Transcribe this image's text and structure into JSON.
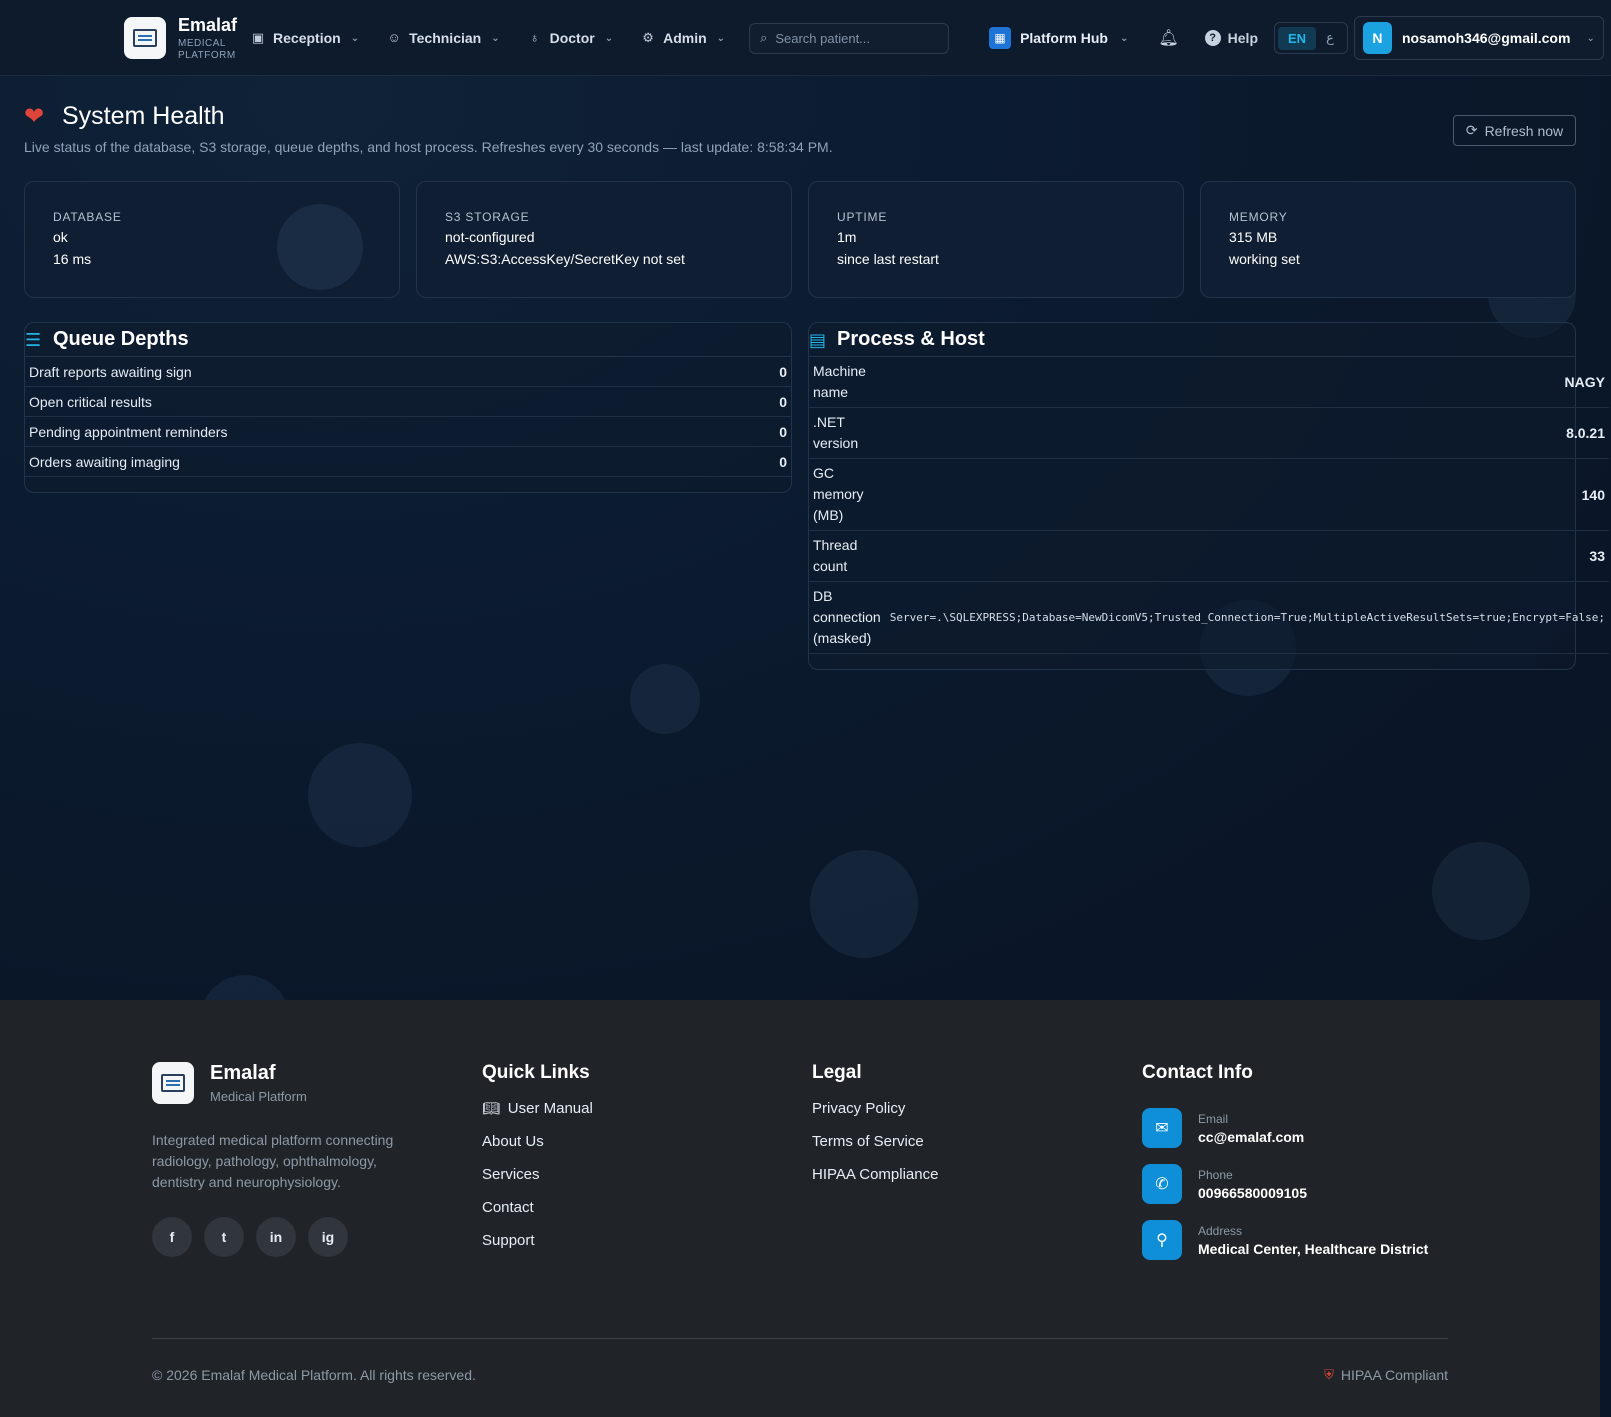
{
  "navbar": {
    "brand_name": "Emalaf",
    "brand_sub_1": "MEDICAL",
    "brand_sub_2": "PLATFORM",
    "menu": [
      {
        "label": "Reception",
        "icon": "clipboard-icon"
      },
      {
        "label": "Technician",
        "icon": "user-icon"
      },
      {
        "label": "Doctor",
        "icon": "stethoscope-icon"
      },
      {
        "label": "Admin",
        "icon": "gear-icon"
      }
    ],
    "search_placeholder": "Search patient...",
    "platform_hub": "Platform Hub",
    "help": "Help",
    "lang_en": "EN",
    "lang_ar": "ع",
    "user_initial": "N",
    "user_email": "nosamoh346@gmail.com"
  },
  "page": {
    "title": "System Health",
    "subtitle": "Live status of the database, S3 storage, queue depths, and host process. Refreshes every 30 seconds — last update: 8:58:34 PM.",
    "refresh_label": "Refresh now"
  },
  "stats": [
    {
      "label": "DATABASE",
      "value": "ok",
      "detail": "16 ms"
    },
    {
      "label": "S3 STORAGE",
      "value": "not-configured",
      "detail": "AWS:S3:AccessKey/SecretKey not set"
    },
    {
      "label": "UPTIME",
      "value": "1m",
      "detail": "since last restart"
    },
    {
      "label": "MEMORY",
      "value": "315 MB",
      "detail": "working set"
    }
  ],
  "queue": {
    "title": "Queue Depths",
    "rows": [
      {
        "label": "Draft reports awaiting sign",
        "value": "0"
      },
      {
        "label": "Open critical results",
        "value": "0"
      },
      {
        "label": "Pending appointment reminders",
        "value": "0"
      },
      {
        "label": "Orders awaiting imaging",
        "value": "0"
      }
    ]
  },
  "host": {
    "title": "Process & Host",
    "rows": [
      {
        "label": "Machine name",
        "value": "NAGY"
      },
      {
        "label": ".NET version",
        "value": "8.0.21"
      },
      {
        "label": "GC memory (MB)",
        "value": "140"
      },
      {
        "label": "Thread count",
        "value": "33"
      },
      {
        "label": "DB connection (masked)",
        "value": "Server=.\\SQLEXPRESS;Database=NewDicomV5;Trusted_Connection=True;MultipleActiveResultSets=true;Encrypt=False;"
      }
    ]
  },
  "footer": {
    "brand_name": "Emalaf",
    "brand_sub": "Medical Platform",
    "description": "Integrated medical platform connecting radiology, pathology, ophthalmology, dentistry and neurophysiology.",
    "socials": [
      "f",
      "t",
      "in",
      "ig"
    ],
    "quick_links_title": "Quick Links",
    "quick_links": [
      "User Manual",
      "About Us",
      "Services",
      "Contact",
      "Support"
    ],
    "legal_title": "Legal",
    "legal_links": [
      "Privacy Policy",
      "Terms of Service",
      "HIPAA Compliance"
    ],
    "contact_title": "Contact Info",
    "contact": [
      {
        "label": "Email",
        "value": "cc@emalaf.com",
        "icon": "envelope-icon"
      },
      {
        "label": "Phone",
        "value": "00966580009105",
        "icon": "phone-icon"
      },
      {
        "label": "Address",
        "value": "Medical Center, Healthcare District",
        "icon": "map-pin-icon"
      }
    ],
    "copyright": "© 2026 Emalaf Medical Platform. All rights reserved.",
    "hipaa_badge": "HIPAA Compliant"
  }
}
